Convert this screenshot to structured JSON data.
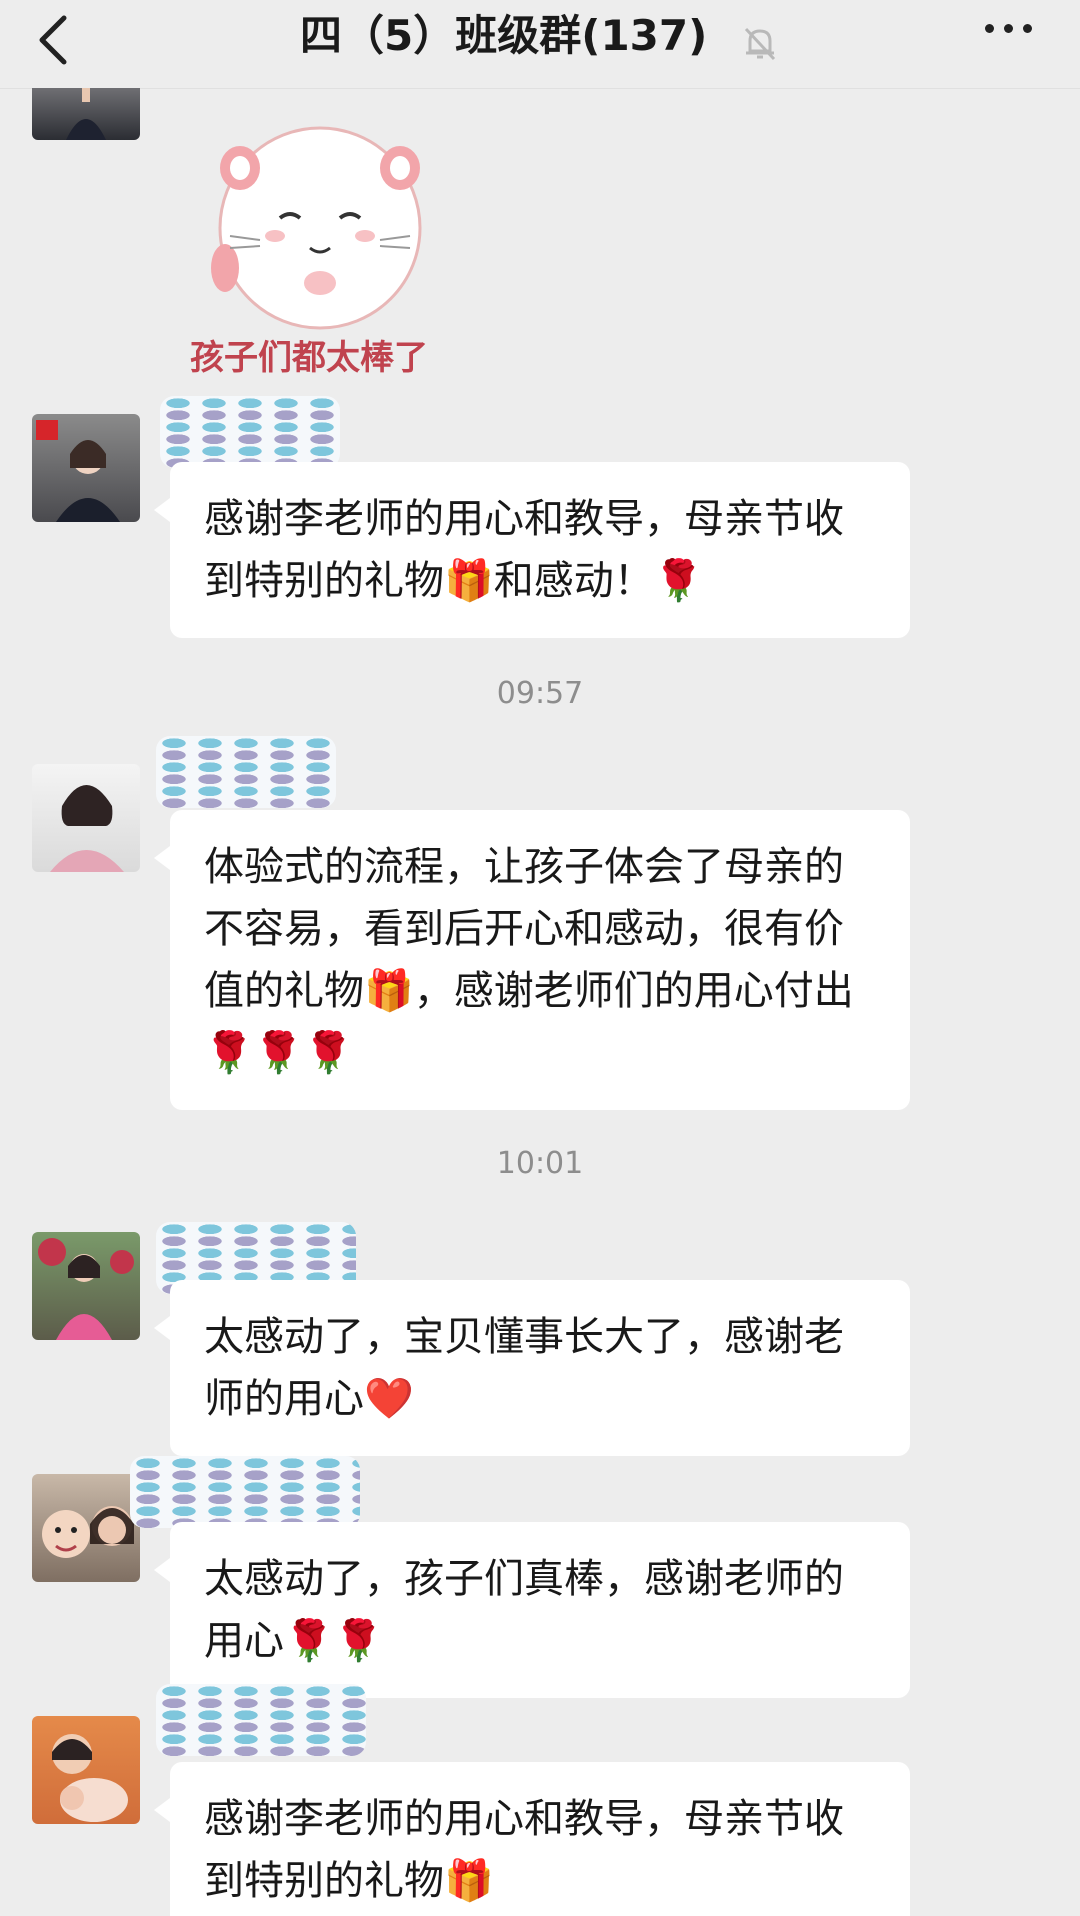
{
  "header": {
    "title": "四（5）班级群(137)",
    "back_label": "<",
    "mute_icon": "bell-off-icon",
    "more_icon": "more-dots-icon"
  },
  "sticker": {
    "caption": "孩子们都太棒了"
  },
  "messages": [
    {
      "text": "感谢李老师的用心和教导，母亲节收到特别的礼物🎁和感动！🌹"
    },
    {
      "text": "体验式的流程，让孩子体会了母亲的不容易，看到后开心和感动，很有价值的礼物🎁，感谢老师们的用心付出🌹🌹🌹"
    },
    {
      "text": "太感动了，宝贝懂事长大了，感谢老师的用心❤️"
    },
    {
      "text": "太感动了，孩子们真棒，感谢老师的用心🌹🌹"
    },
    {
      "text": "感谢李老师的用心和教导，母亲节收到特别的礼物🎁"
    }
  ],
  "timestamps": [
    "09:57",
    "10:01"
  ],
  "colors": {
    "background": "#ededed",
    "bubble": "#ffffff",
    "text": "#191919",
    "timestamp": "#8d8d8d"
  }
}
